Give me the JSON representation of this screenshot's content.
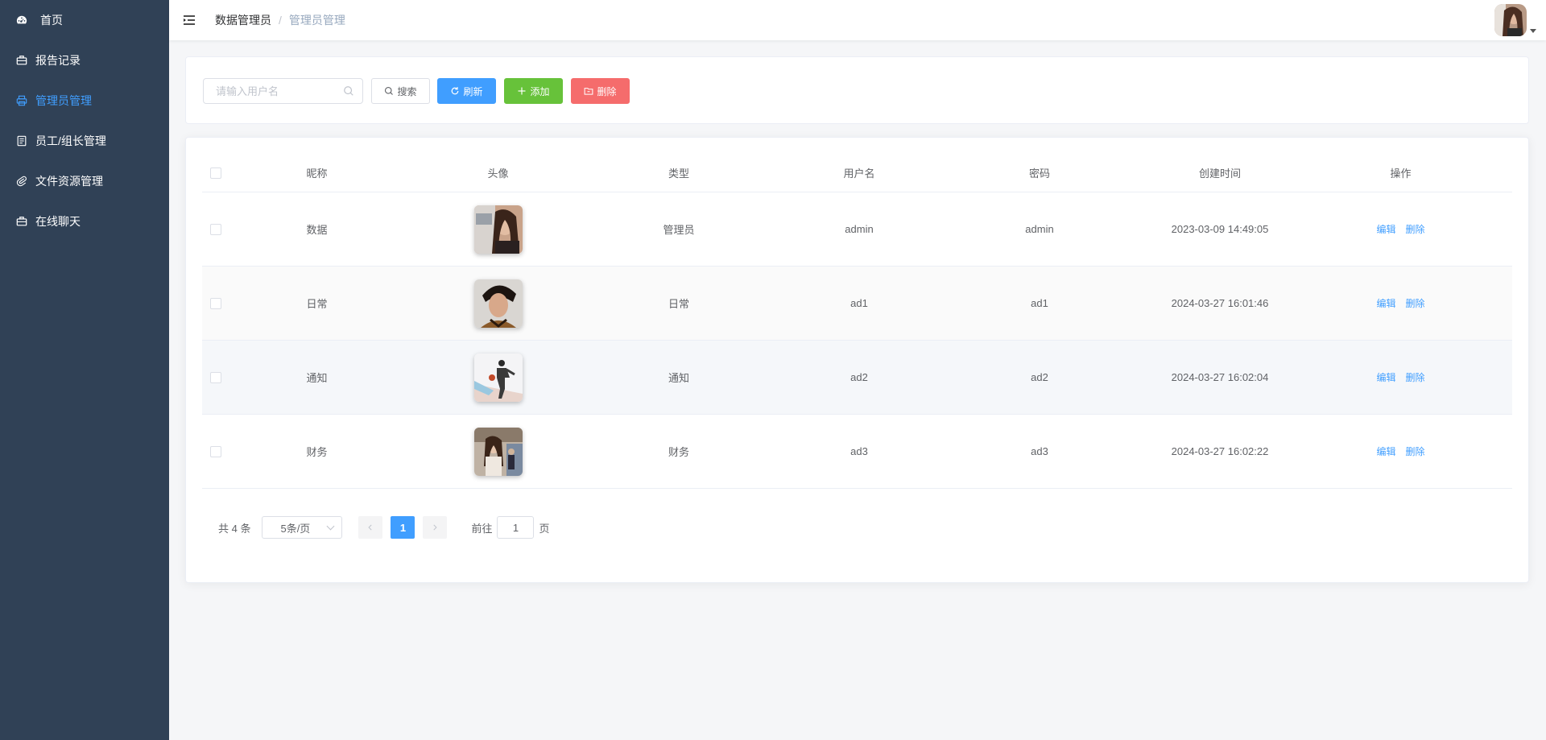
{
  "sidebar": {
    "items": [
      {
        "label": "首页",
        "icon": "dashboard-icon",
        "active": false
      },
      {
        "label": "报告记录",
        "icon": "briefcase-icon",
        "active": false
      },
      {
        "label": "管理员管理",
        "icon": "printer-icon",
        "active": true
      },
      {
        "label": "员工/组长管理",
        "icon": "document-icon",
        "active": false
      },
      {
        "label": "文件资源管理",
        "icon": "paperclip-icon",
        "active": false
      },
      {
        "label": "在线聊天",
        "icon": "briefcase-icon",
        "active": false
      }
    ]
  },
  "header": {
    "breadcrumb": [
      "数据管理员",
      "管理员管理"
    ],
    "separator": "/"
  },
  "toolbar": {
    "search_placeholder": "请输入用户名",
    "search_label": "搜索",
    "refresh_label": "刷新",
    "add_label": "添加",
    "delete_label": "删除"
  },
  "table": {
    "columns": [
      "昵称",
      "头像",
      "类型",
      "用户名",
      "密码",
      "创建时间",
      "操作"
    ],
    "rows": [
      {
        "nickname": "数据",
        "type": "管理员",
        "username": "admin",
        "password": "admin",
        "created": "2023-03-09 14:49:05",
        "edit": "编辑",
        "delete": "删除"
      },
      {
        "nickname": "日常",
        "type": "日常",
        "username": "ad1",
        "password": "ad1",
        "created": "2024-03-27 16:01:46",
        "edit": "编辑",
        "delete": "删除"
      },
      {
        "nickname": "通知",
        "type": "通知",
        "username": "ad2",
        "password": "ad2",
        "created": "2024-03-27 16:02:04",
        "edit": "编辑",
        "delete": "删除"
      },
      {
        "nickname": "财务",
        "type": "财务",
        "username": "ad3",
        "password": "ad3",
        "created": "2024-03-27 16:02:22",
        "edit": "编辑",
        "delete": "删除"
      }
    ]
  },
  "pagination": {
    "total_text": "共 4 条",
    "page_size": "5条/页",
    "current_page": "1",
    "goto_prefix": "前往",
    "goto_value": "1",
    "goto_suffix": "页"
  },
  "colors": {
    "sidebar_bg": "#304156",
    "primary": "#409eff",
    "success": "#67c23a",
    "danger": "#f56c6c"
  }
}
